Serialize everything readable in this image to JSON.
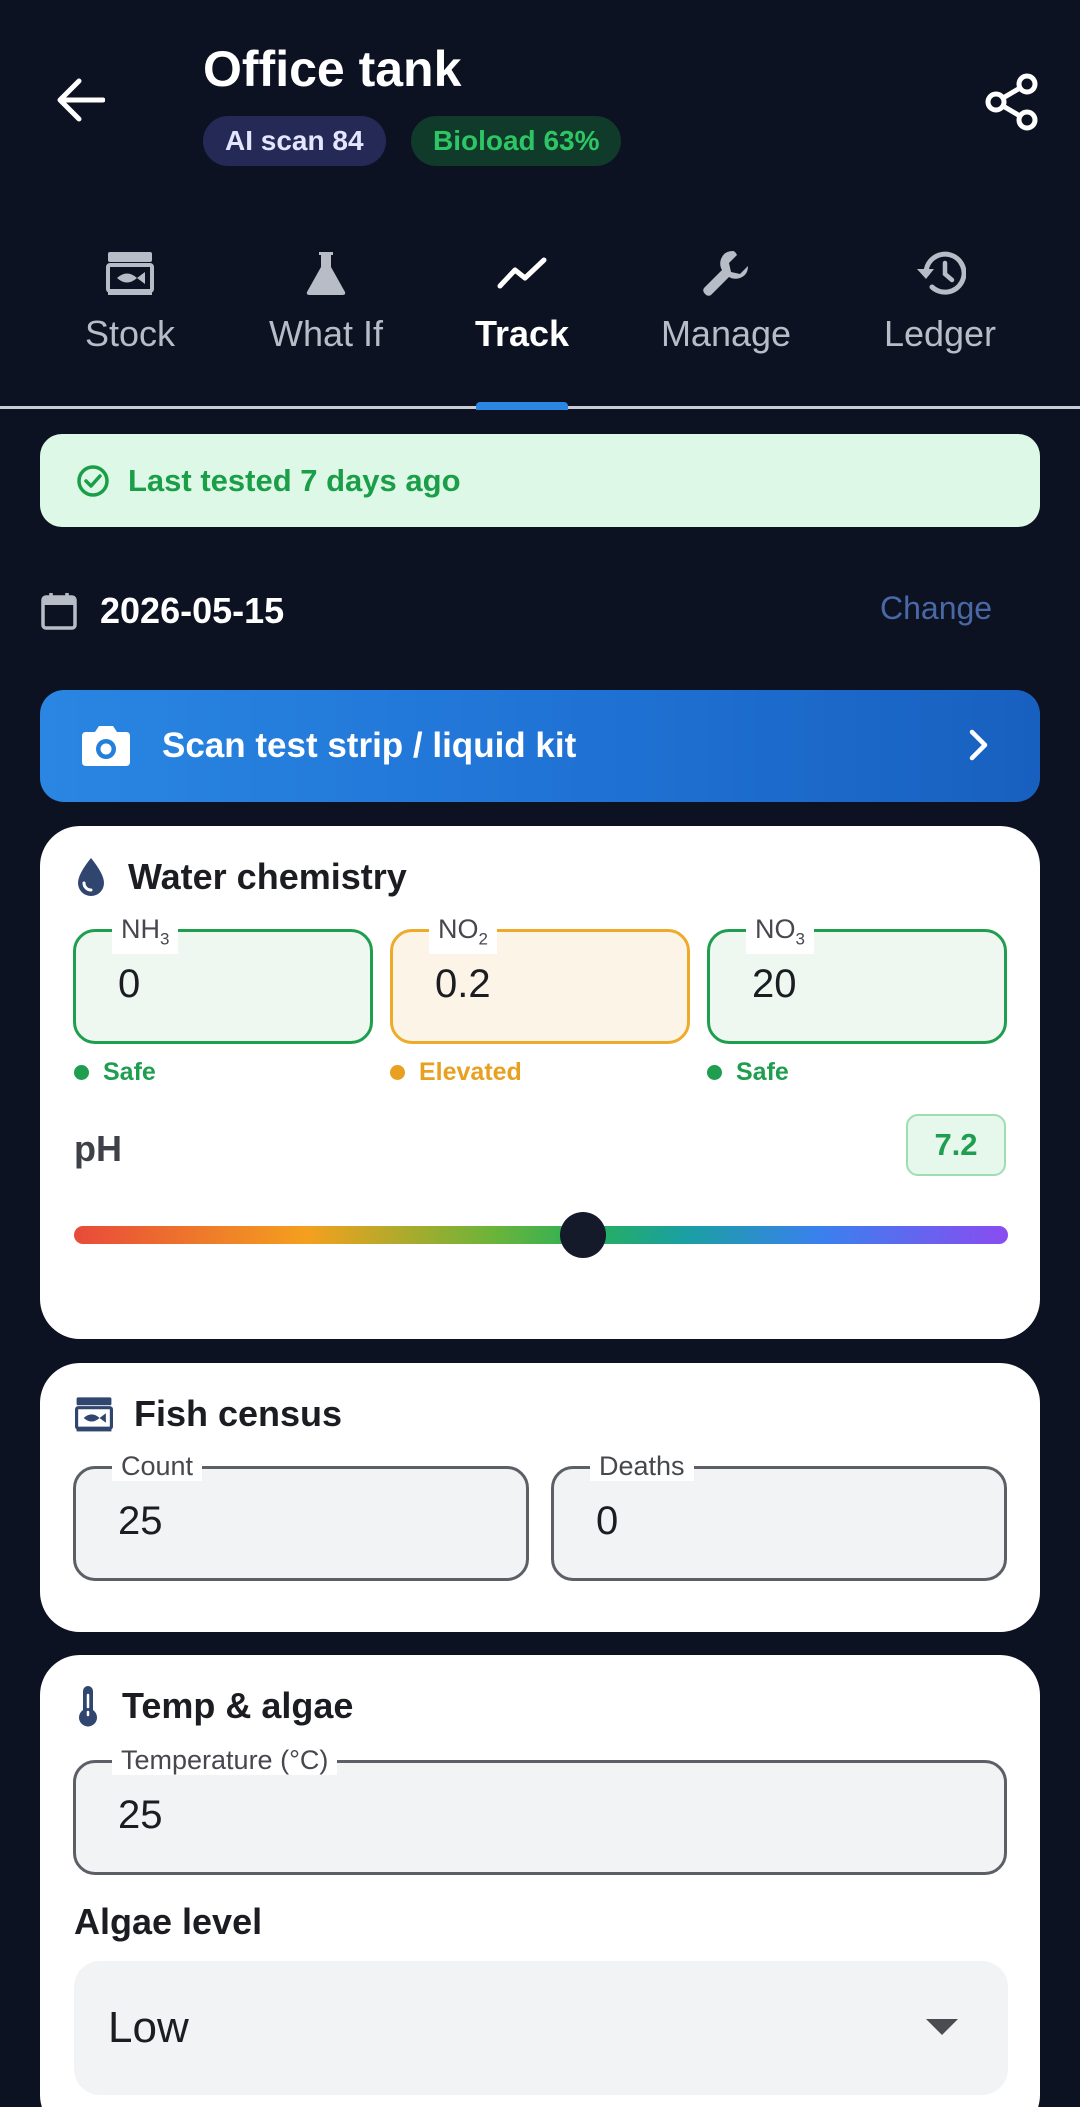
{
  "header": {
    "title": "Office tank",
    "ai_scan_chip": "AI scan 84",
    "bioload_chip": "Bioload 63%"
  },
  "tabs": [
    {
      "label": "Stock",
      "icon": "fish-tank-icon",
      "active": false
    },
    {
      "label": "What If",
      "icon": "flask-icon",
      "active": false
    },
    {
      "label": "Track",
      "icon": "trend-line-icon",
      "active": true
    },
    {
      "label": "Manage",
      "icon": "wrench-icon",
      "active": false
    },
    {
      "label": "Ledger",
      "icon": "history-icon",
      "active": false
    }
  ],
  "banner": {
    "text": "Last tested 7 days ago"
  },
  "date": {
    "value": "2026-05-15",
    "change_label": "Change"
  },
  "scan_button": {
    "label": "Scan test strip / liquid kit"
  },
  "water_chemistry": {
    "title": "Water chemistry",
    "nh3": {
      "label_main": "NH",
      "label_sub": "3",
      "value": "0",
      "status": "Safe"
    },
    "no2": {
      "label_main": "NO",
      "label_sub": "2",
      "value": "0.2",
      "status": "Elevated"
    },
    "no3": {
      "label_main": "NO",
      "label_sub": "3",
      "value": "20",
      "status": "Safe"
    },
    "ph": {
      "label": "pH",
      "value": "7.2",
      "slider_fraction": 0.545
    }
  },
  "fish_census": {
    "title": "Fish census",
    "count": {
      "label": "Count",
      "value": "25"
    },
    "deaths": {
      "label": "Deaths",
      "value": "0"
    }
  },
  "temp_algae": {
    "title": "Temp & algae",
    "temperature": {
      "label": "Temperature (°C)",
      "value": "25"
    },
    "algae_label": "Algae level",
    "algae_value": "Low"
  },
  "colors": {
    "background": "#0c1222",
    "accent": "#2a86e2",
    "safe": "#1f9e50",
    "elevated": "#e8a020"
  }
}
